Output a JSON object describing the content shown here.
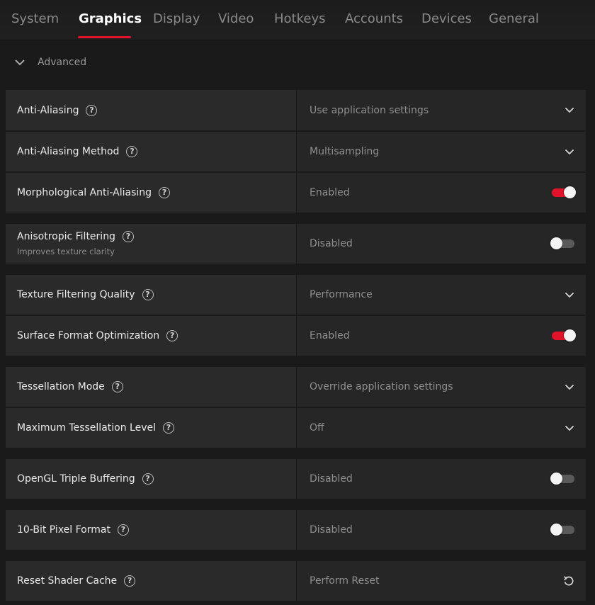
{
  "tabs": [
    "System",
    "Graphics",
    "Display",
    "Video",
    "Hotkeys",
    "Accounts",
    "Devices",
    "General"
  ],
  "active_tab": "Graphics",
  "accent_color": "#e0132a",
  "advanced": {
    "label": "Advanced",
    "icon": "chevron-down-icon"
  },
  "settings": [
    {
      "label": "Anti-Aliasing",
      "value": "Use application settings",
      "control": "dropdown"
    },
    {
      "label": "Anti-Aliasing Method",
      "value": "Multisampling",
      "control": "dropdown"
    },
    {
      "label": "Morphological Anti-Aliasing",
      "value": "Enabled",
      "control": "toggle",
      "on": true
    },
    {
      "label": "Anisotropic Filtering",
      "sublabel": "Improves texture clarity",
      "value": "Disabled",
      "control": "toggle",
      "on": false
    },
    {
      "label": "Texture Filtering Quality",
      "value": "Performance",
      "control": "dropdown"
    },
    {
      "label": "Surface Format Optimization",
      "value": "Enabled",
      "control": "toggle",
      "on": true
    },
    {
      "label": "Tessellation Mode",
      "value": "Override application settings",
      "control": "dropdown"
    },
    {
      "label": "Maximum Tessellation Level",
      "value": "Off",
      "control": "dropdown"
    },
    {
      "label": "OpenGL Triple Buffering",
      "value": "Disabled",
      "control": "toggle",
      "on": false
    },
    {
      "label": "10-Bit Pixel Format",
      "value": "Disabled",
      "control": "toggle",
      "on": false
    },
    {
      "label": "Reset Shader Cache",
      "value": "Perform Reset",
      "control": "reset"
    }
  ]
}
